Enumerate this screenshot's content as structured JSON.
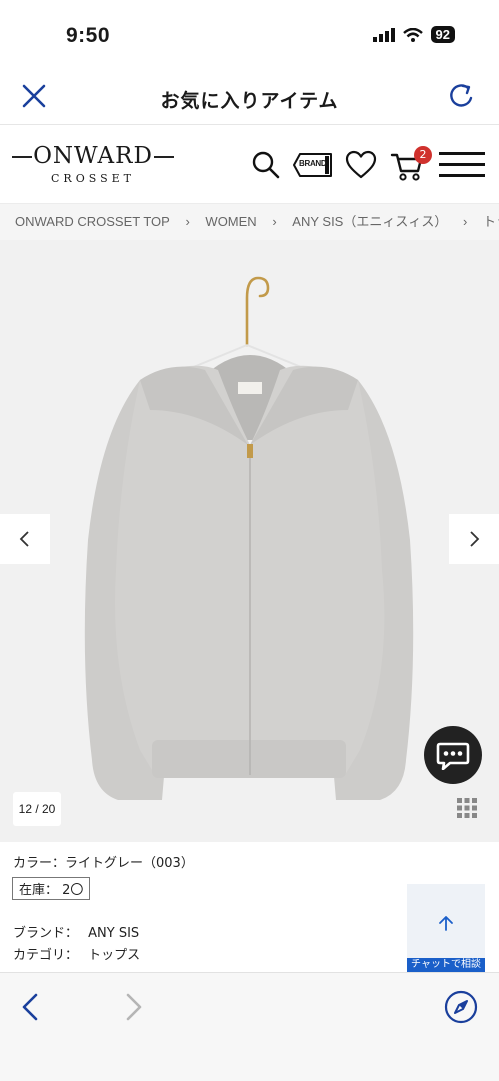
{
  "status_bar": {
    "time": "9:50",
    "battery": "92"
  },
  "nav": {
    "title": "お気に入りアイテム"
  },
  "logo": {
    "main": "ONWARD",
    "sub": "CROSSET"
  },
  "header": {
    "brand_icon_label": "BRAND",
    "cart_count": "2"
  },
  "breadcrumb": [
    "ONWARD CROSSET TOP",
    "WOMEN",
    "ANY SIS（エニィスィス）",
    "トップス"
  ],
  "gallery": {
    "counter": "12 / 20"
  },
  "product": {
    "color": "カラー：ライトグレー（003）",
    "stock": "在庫： 2〇",
    "brand_label": "ブランド：",
    "brand_value": "ANY SIS",
    "category_label": "カテゴリ：",
    "category_value": "トップス"
  },
  "scroll_top": {
    "label": "チャットで相談"
  },
  "colors": {
    "accent": "#1a3f9c",
    "link_blue": "#1a5fc9",
    "badge_red": "#d0312d"
  }
}
